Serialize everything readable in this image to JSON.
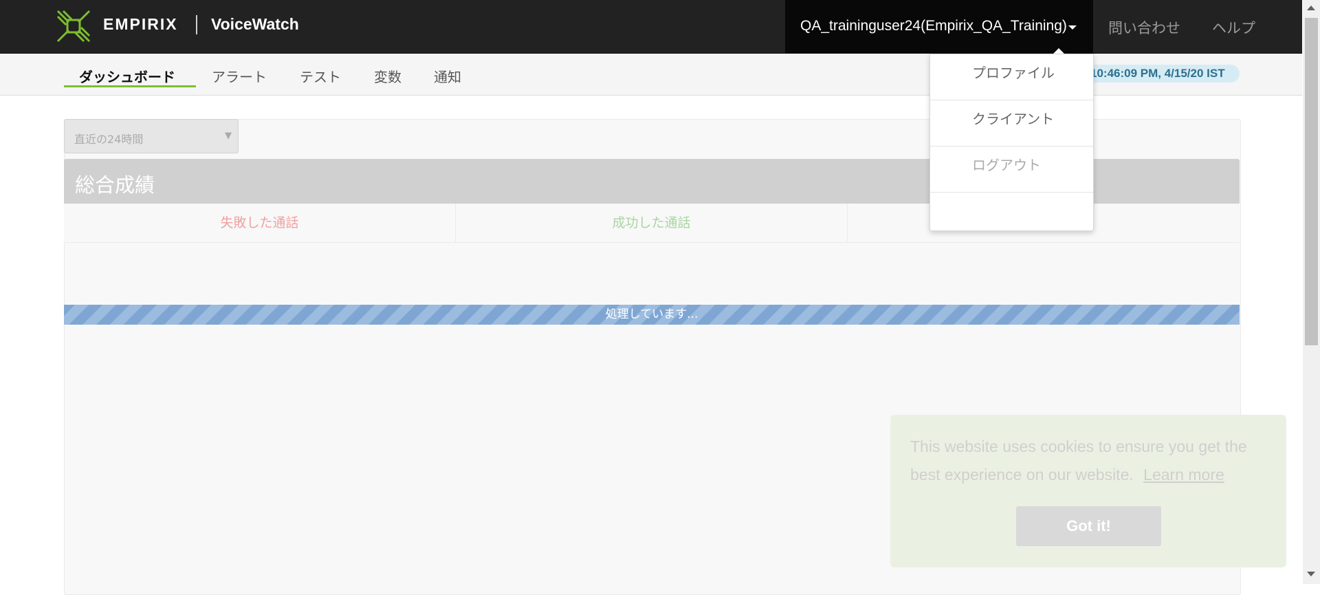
{
  "header": {
    "brand": "EMPIRIX",
    "product": "VoiceWatch",
    "user_menu": "QA_traininguser24(Empirix_QA_Training)",
    "links": {
      "contact": "問い合わせ",
      "help": "ヘルプ"
    }
  },
  "nav": {
    "tabs": [
      {
        "label": "ダッシュボード",
        "active": true
      },
      {
        "label": "アラート"
      },
      {
        "label": "テスト"
      },
      {
        "label": "変数"
      },
      {
        "label": "通知"
      }
    ],
    "timestamp": "10:46:09 PM, 4/15/20 IST"
  },
  "dropdown": {
    "items": [
      {
        "label": "プロファイル"
      },
      {
        "label": "クライアント"
      },
      {
        "label": "ログアウト",
        "disabled": true
      }
    ]
  },
  "main": {
    "period_select": "直近の24時間",
    "summary_title": "総合成績",
    "metrics": [
      {
        "label": "失敗した通話",
        "color": "#f0a0a0"
      },
      {
        "label": "成功した通話",
        "color": "#a8d6a0"
      }
    ],
    "progress_label": "処理しています..."
  },
  "cookie": {
    "message": "This website uses cookies to ensure you get the best experience on our website.",
    "learn_more": "Learn more",
    "button": "Got it!"
  },
  "colors": {
    "accent": "#7dbf2f",
    "topbar": "#222222",
    "progress": "#8cb1d9"
  },
  "icons": {
    "logo": "empirix-logo-icon",
    "caret": "caret-down-icon",
    "select_arrow": "triangle-down-icon"
  }
}
